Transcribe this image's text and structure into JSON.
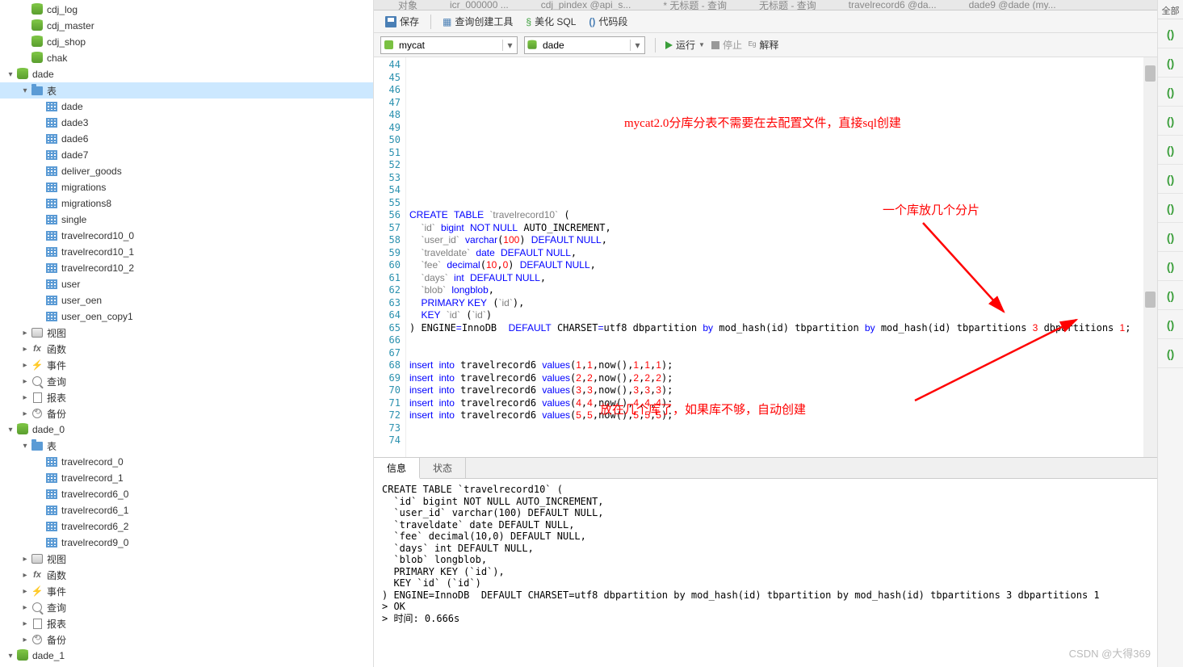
{
  "sidebar": {
    "items": [
      {
        "indent": 1,
        "exp": "",
        "icon": "db",
        "label": "cdj_log"
      },
      {
        "indent": 1,
        "exp": "",
        "icon": "db",
        "label": "cdj_master"
      },
      {
        "indent": 1,
        "exp": "",
        "icon": "db",
        "label": "cdj_shop"
      },
      {
        "indent": 1,
        "exp": "",
        "icon": "db",
        "label": "chak"
      },
      {
        "indent": 0,
        "exp": "▾",
        "icon": "db",
        "label": "dade"
      },
      {
        "indent": 1,
        "exp": "▾",
        "icon": "folder",
        "label": "表",
        "sel": true
      },
      {
        "indent": 2,
        "exp": "",
        "icon": "table",
        "label": "dade"
      },
      {
        "indent": 2,
        "exp": "",
        "icon": "table",
        "label": "dade3"
      },
      {
        "indent": 2,
        "exp": "",
        "icon": "table",
        "label": "dade6"
      },
      {
        "indent": 2,
        "exp": "",
        "icon": "table",
        "label": "dade7"
      },
      {
        "indent": 2,
        "exp": "",
        "icon": "table",
        "label": "deliver_goods"
      },
      {
        "indent": 2,
        "exp": "",
        "icon": "table",
        "label": "migrations"
      },
      {
        "indent": 2,
        "exp": "",
        "icon": "table",
        "label": "migrations8"
      },
      {
        "indent": 2,
        "exp": "",
        "icon": "table",
        "label": "single"
      },
      {
        "indent": 2,
        "exp": "",
        "icon": "table",
        "label": "travelrecord10_0"
      },
      {
        "indent": 2,
        "exp": "",
        "icon": "table",
        "label": "travelrecord10_1"
      },
      {
        "indent": 2,
        "exp": "",
        "icon": "table",
        "label": "travelrecord10_2"
      },
      {
        "indent": 2,
        "exp": "",
        "icon": "table",
        "label": "user"
      },
      {
        "indent": 2,
        "exp": "",
        "icon": "table",
        "label": "user_oen"
      },
      {
        "indent": 2,
        "exp": "",
        "icon": "table",
        "label": "user_oen_copy1"
      },
      {
        "indent": 1,
        "exp": "▸",
        "icon": "view",
        "label": "视图"
      },
      {
        "indent": 1,
        "exp": "▸",
        "icon": "fx",
        "label": "函数"
      },
      {
        "indent": 1,
        "exp": "▸",
        "icon": "event",
        "label": "事件"
      },
      {
        "indent": 1,
        "exp": "▸",
        "icon": "query",
        "label": "查询"
      },
      {
        "indent": 1,
        "exp": "▸",
        "icon": "report",
        "label": "报表"
      },
      {
        "indent": 1,
        "exp": "▸",
        "icon": "backup",
        "label": "备份"
      },
      {
        "indent": 0,
        "exp": "▾",
        "icon": "db",
        "label": "dade_0"
      },
      {
        "indent": 1,
        "exp": "▾",
        "icon": "folder",
        "label": "表"
      },
      {
        "indent": 2,
        "exp": "",
        "icon": "table",
        "label": "travelrecord_0"
      },
      {
        "indent": 2,
        "exp": "",
        "icon": "table",
        "label": "travelrecord_1"
      },
      {
        "indent": 2,
        "exp": "",
        "icon": "table",
        "label": "travelrecord6_0"
      },
      {
        "indent": 2,
        "exp": "",
        "icon": "table",
        "label": "travelrecord6_1"
      },
      {
        "indent": 2,
        "exp": "",
        "icon": "table",
        "label": "travelrecord6_2"
      },
      {
        "indent": 2,
        "exp": "",
        "icon": "table",
        "label": "travelrecord9_0"
      },
      {
        "indent": 1,
        "exp": "▸",
        "icon": "view",
        "label": "视图"
      },
      {
        "indent": 1,
        "exp": "▸",
        "icon": "fx",
        "label": "函数"
      },
      {
        "indent": 1,
        "exp": "▸",
        "icon": "event",
        "label": "事件"
      },
      {
        "indent": 1,
        "exp": "▸",
        "icon": "query",
        "label": "查询"
      },
      {
        "indent": 1,
        "exp": "▸",
        "icon": "report",
        "label": "报表"
      },
      {
        "indent": 1,
        "exp": "▸",
        "icon": "backup",
        "label": "备份"
      },
      {
        "indent": 0,
        "exp": "▾",
        "icon": "db",
        "label": "dade_1"
      }
    ]
  },
  "tabs_top": [
    "对象",
    "icr_000000 ...",
    "cdj_pindex @api_s...",
    "* 无标题 - 查询",
    "无标题 - 查询",
    "travelrecord6 @da...",
    "dade9 @dade (my..."
  ],
  "toolbar1": {
    "save": "保存",
    "query_tool": "查询创建工具",
    "beautify": "美化 SQL",
    "snippet": "代码段"
  },
  "toolbar2": {
    "conn": "mycat",
    "db": "dade",
    "run": "运行",
    "stop": "停止",
    "explain": "解释"
  },
  "editor": {
    "first_line": 44,
    "last_line": 74,
    "annotations": {
      "a1": "mycat2.0分库分表不需要在去配置文件，直接sql创建",
      "a2": "一个库放几个分片",
      "a3": "放在几个库了，如果库不够，自动创建"
    }
  },
  "results": {
    "tabs": {
      "info": "信息",
      "status": "状态"
    },
    "body": "CREATE TABLE `travelrecord10` (\n  `id` bigint NOT NULL AUTO_INCREMENT,\n  `user_id` varchar(100) DEFAULT NULL,\n  `traveldate` date DEFAULT NULL,\n  `fee` decimal(10,0) DEFAULT NULL,\n  `days` int DEFAULT NULL,\n  `blob` longblob,\n  PRIMARY KEY (`id`),\n  KEY `id` (`id`)\n) ENGINE=InnoDB  DEFAULT CHARSET=utf8 dbpartition by mod_hash(id) tbpartition by mod_hash(id) tbpartitions 3 dbpartitions 1\n> OK\n> 时间: 0.666s"
  },
  "rightbar": {
    "head": "全部"
  },
  "watermark": "CSDN @大得369"
}
